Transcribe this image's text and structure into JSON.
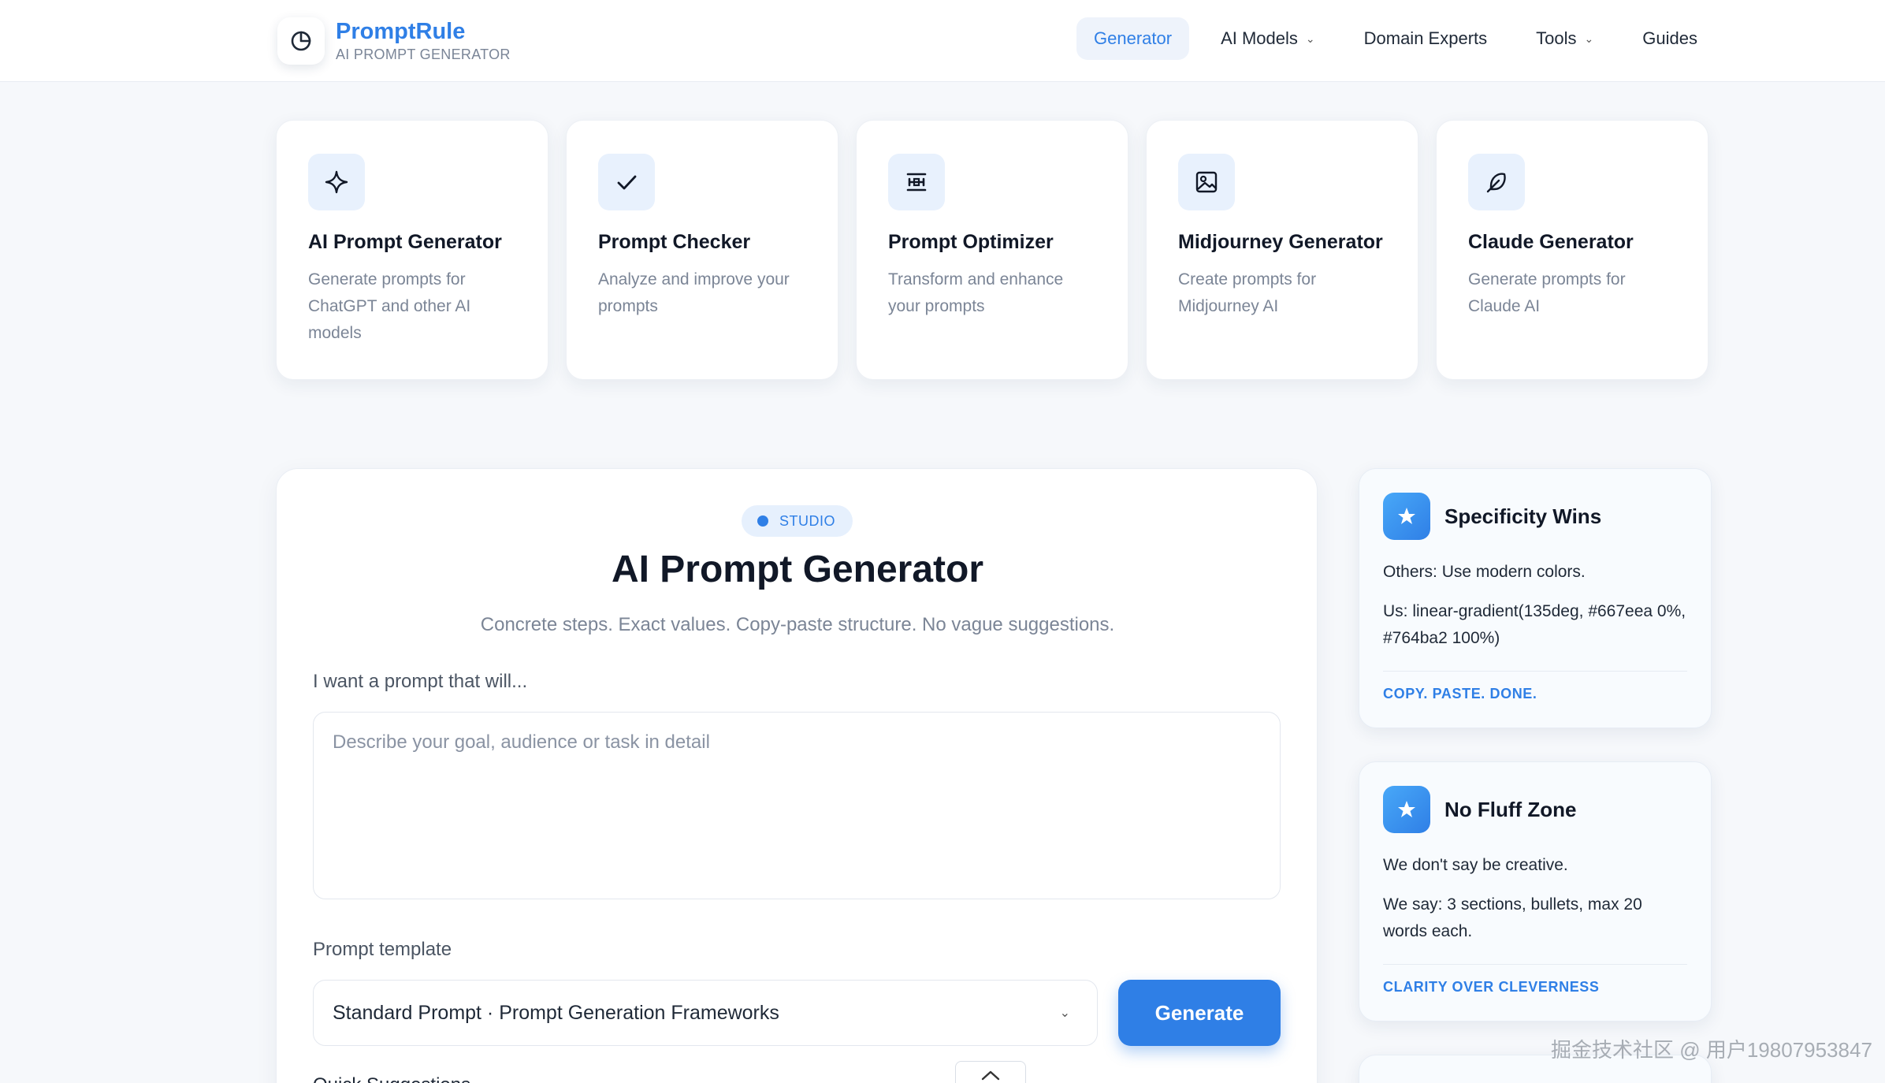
{
  "brand": {
    "name": "PromptRule",
    "tagline": "AI PROMPT GENERATOR"
  },
  "nav": {
    "items": [
      {
        "label": "Generator",
        "active": true,
        "dropdown": false
      },
      {
        "label": "AI Models",
        "active": false,
        "dropdown": true
      },
      {
        "label": "Domain Experts",
        "active": false,
        "dropdown": false
      },
      {
        "label": "Tools",
        "active": false,
        "dropdown": true
      },
      {
        "label": "Guides",
        "active": false,
        "dropdown": false
      }
    ]
  },
  "tools": [
    {
      "icon": "sparkle-icon",
      "title": "AI Prompt Generator",
      "desc": "Generate prompts for ChatGPT and other AI models"
    },
    {
      "icon": "check-icon",
      "title": "Prompt Checker",
      "desc": "Analyze and improve your prompts"
    },
    {
      "icon": "optimize-icon",
      "title": "Prompt Optimizer",
      "desc": "Transform and enhance your prompts"
    },
    {
      "icon": "image-icon",
      "title": "Midjourney Generator",
      "desc": "Create prompts for Midjourney AI"
    },
    {
      "icon": "feather-icon",
      "title": "Claude Generator",
      "desc": "Generate prompts for Claude AI"
    }
  ],
  "studio": {
    "badge": "STUDIO",
    "title": "AI Prompt Generator",
    "subtitle": "Concrete steps. Exact values. Copy-paste structure. No vague suggestions.",
    "goal_label": "I want a prompt that will...",
    "goal_placeholder": "Describe your goal, audience or task in detail",
    "template_label": "Prompt template",
    "template_value": "Standard Prompt · Prompt Generation Frameworks",
    "generate_label": "Generate",
    "quick_label": "Quick Suggestions"
  },
  "tips": [
    {
      "title": "Specificity Wins",
      "line1": "Others: Use modern colors.",
      "line2": "Us: linear-gradient(135deg, #667eea 0%, #764ba2 100%)",
      "footer": "COPY. PASTE. DONE."
    },
    {
      "title": "No Fluff Zone",
      "line1": "We don't say be creative.",
      "line2": "We say: 3 sections, bullets, max 20 words each.",
      "footer": "CLARITY OVER CLEVERNESS"
    }
  ],
  "watermark": "掘金技术社区 @ 用户19807953847",
  "colors": {
    "accent": "#2f7fe6",
    "icon_bg": "#e8f1fd",
    "page_bg": "#f6f8fb"
  }
}
